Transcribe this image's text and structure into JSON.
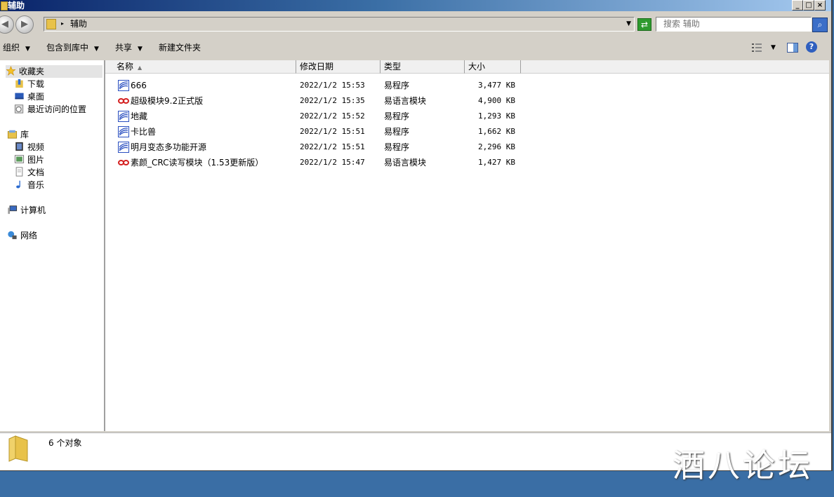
{
  "window": {
    "title": "辅助",
    "buttons": {
      "minimize": "_",
      "maximize": "□",
      "close": "×"
    }
  },
  "address": {
    "path": "辅助",
    "search_placeholder": "搜索 辅助"
  },
  "toolbar": {
    "organize": "组织",
    "include_in_library": "包含到库中",
    "share": "共享",
    "new_folder": "新建文件夹"
  },
  "nav": {
    "favorites": {
      "label": "收藏夹",
      "items": [
        "下载",
        "桌面",
        "最近访问的位置"
      ]
    },
    "libraries": {
      "label": "库",
      "items": [
        "视频",
        "图片",
        "文档",
        "音乐"
      ]
    },
    "computer": "计算机",
    "network": "网络"
  },
  "columns": [
    "名称",
    "修改日期",
    "类型",
    "大小"
  ],
  "files": [
    {
      "name": "666",
      "date": "2022/1/2 15:53",
      "type": "易程序",
      "size": "3,477 KB",
      "icon": "e-program-icon"
    },
    {
      "name": "超级模块9.2正式版",
      "date": "2022/1/2 15:35",
      "type": "易语言模块",
      "size": "4,900 KB",
      "icon": "e-module-icon"
    },
    {
      "name": "地藏",
      "date": "2022/1/2 15:52",
      "type": "易程序",
      "size": "1,293 KB",
      "icon": "e-program-icon"
    },
    {
      "name": "卡比兽",
      "date": "2022/1/2 15:51",
      "type": "易程序",
      "size": "1,662 KB",
      "icon": "e-program-icon"
    },
    {
      "name": "明月变态多功能开源",
      "date": "2022/1/2 15:51",
      "type": "易程序",
      "size": "2,296 KB",
      "icon": "e-program-icon"
    },
    {
      "name": "素颜_CRC读写模块（1.53更新版）",
      "date": "2022/1/2 15:47",
      "type": "易语言模块",
      "size": "1,427 KB",
      "icon": "e-module-icon"
    }
  ],
  "details": {
    "count": "6 个对象"
  },
  "watermark": "酒八论坛",
  "colors": {
    "desktop": "#3a6ea5",
    "titlebar_start": "#0a246a",
    "program_icon": "#2a4fc0",
    "module_icon": "#d42020"
  }
}
